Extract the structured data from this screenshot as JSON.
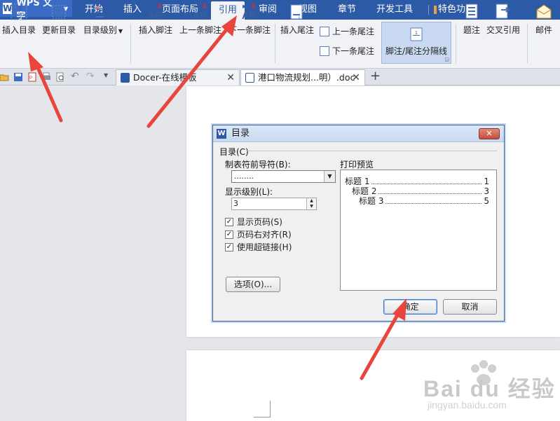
{
  "app": {
    "name": "WPS 文字",
    "logo_letter": "W"
  },
  "menubar": {
    "tabs": [
      {
        "label": "开始"
      },
      {
        "label": "插入"
      },
      {
        "label": "页面布局"
      },
      {
        "label": "引用",
        "active": true
      },
      {
        "label": "审阅"
      },
      {
        "label": "视图"
      },
      {
        "label": "章节"
      },
      {
        "label": "开发工具"
      },
      {
        "label": "特色功能"
      }
    ]
  },
  "ribbon": {
    "insert_toc": "插入目录",
    "update_toc": "更新目录",
    "toc_level": "目录级别",
    "insert_footnote": "插入脚注",
    "prev_footnote": "上一条脚注",
    "next_footnote": "下一条脚注",
    "insert_endnote": "插入尾注",
    "prev_endnote": "上一条尾注",
    "next_endnote": "下一条尾注",
    "footnote_separator": "脚注/尾注分隔线",
    "caption": "题注",
    "cross_reference": "交叉引用",
    "mail": "邮件"
  },
  "tabs": [
    {
      "label": "Docer-在线模板",
      "active": false
    },
    {
      "label": "港口物流规划...明）.doc",
      "active": true
    }
  ],
  "dialog": {
    "title": "目录",
    "group_label": "目录(C)",
    "leader_label": "制表符前导符(B):",
    "leader_value": "........",
    "level_label": "显示级别(L):",
    "level_value": "3",
    "show_page_numbers": "显示页码(S)",
    "right_align": "页码右对齐(R)",
    "use_hyperlinks": "使用超链接(H)",
    "preview_label": "打印预览",
    "preview_rows": [
      {
        "text": "标题 1",
        "page": "1"
      },
      {
        "text": "标题 2",
        "page": "3"
      },
      {
        "text": "标题 3",
        "page": "5"
      }
    ],
    "options_button": "选项(O)...",
    "ok_button": "确定",
    "cancel_button": "取消"
  },
  "watermark": {
    "brand": "Bai du 经验",
    "url": "jingyan.baidu.com"
  },
  "colors": {
    "menubar": "#2d5aa6",
    "ribbon": "#f0f2f6",
    "arrow": "#e8453c"
  }
}
